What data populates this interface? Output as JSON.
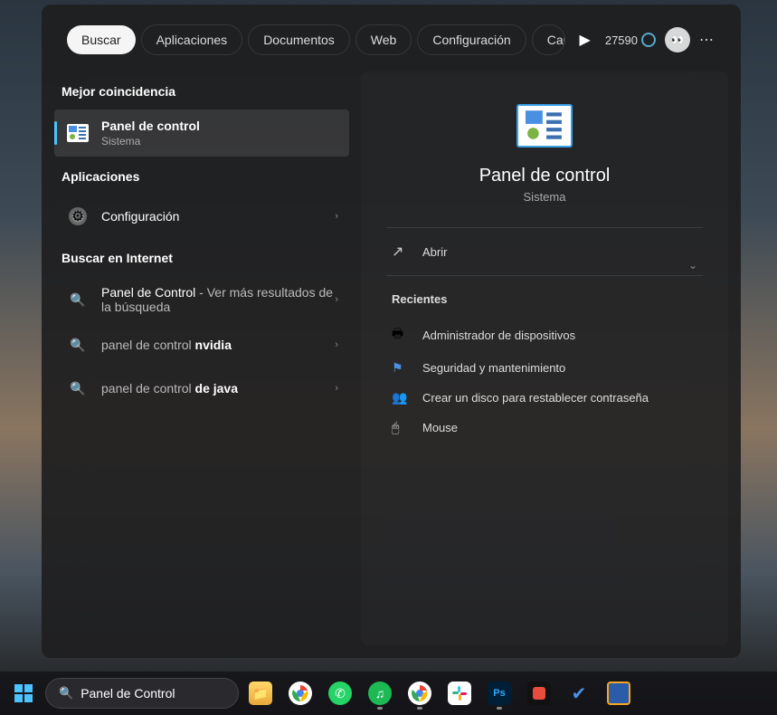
{
  "filters": {
    "search": "Buscar",
    "apps": "Aplicaciones",
    "docs": "Documentos",
    "web": "Web",
    "config": "Configuración",
    "folders": "Carpetas"
  },
  "rewards_points": "27590",
  "left": {
    "best_match": "Mejor coincidencia",
    "main_result": {
      "title": "Panel de control",
      "sub": "Sistema"
    },
    "apps_header": "Aplicaciones",
    "config_item": "Configuración",
    "web_header": "Buscar en Internet",
    "web1": {
      "prefix": "Panel de Control",
      "suffix": " - Ver más resultados de la búsqueda"
    },
    "web2": {
      "prefix": "panel de control ",
      "bold": "nvidia"
    },
    "web3": {
      "prefix": "panel de control ",
      "bold": "de java"
    }
  },
  "right": {
    "title": "Panel de control",
    "sub": "Sistema",
    "open": "Abrir",
    "recent_header": "Recientes",
    "recent": [
      "Administrador de dispositivos",
      "Seguridad y mantenimiento",
      "Crear un disco para restablecer contraseña",
      "Mouse"
    ]
  },
  "taskbar": {
    "search_value": "Panel de Control"
  }
}
